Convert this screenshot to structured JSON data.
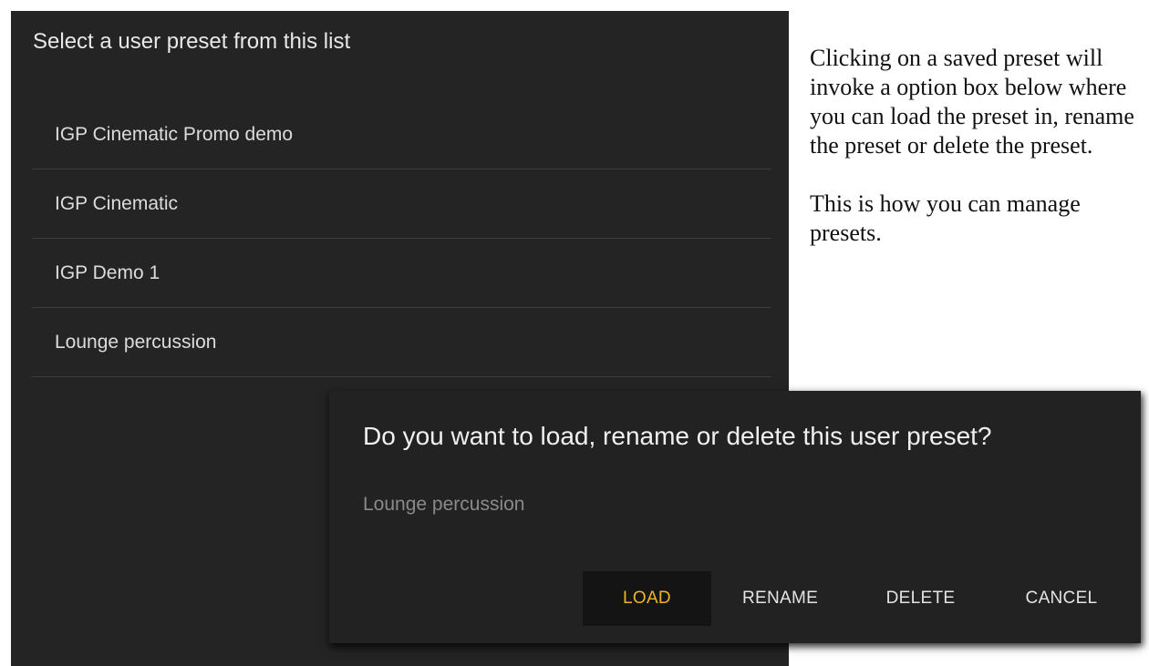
{
  "preset_panel": {
    "title": "Select a user preset from this list",
    "items": [
      {
        "label": "IGP Cinematic Promo demo"
      },
      {
        "label": "IGP Cinematic"
      },
      {
        "label": "IGP Demo 1"
      },
      {
        "label": "Lounge percussion"
      }
    ]
  },
  "help_text": {
    "paragraph_1": "Clicking on a saved preset will invoke a option box below where you can load the preset in, rename the preset or delete the preset.",
    "paragraph_2": "This is how you can manage presets."
  },
  "dialog": {
    "title": "Do you want to load, rename or delete this user preset?",
    "selected_preset": "Lounge percussion",
    "buttons": {
      "load": "LOAD",
      "rename": "RENAME",
      "delete": "DELETE",
      "cancel": "CANCEL"
    }
  },
  "colors": {
    "panel_background": "#242424",
    "dialog_background": "#222222",
    "accent": "#f0b429",
    "divider": "#3c3c3c"
  }
}
